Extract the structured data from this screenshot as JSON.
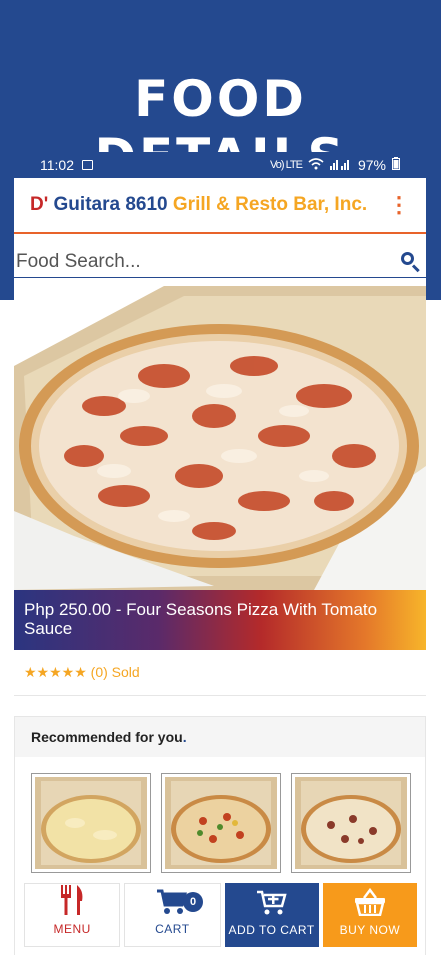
{
  "page": {
    "title": "FOOD DETAILS"
  },
  "status_bar": {
    "time": "11:02",
    "network": "Vo) LTE",
    "battery": "97%"
  },
  "app_bar": {
    "brand_prefix": "D'",
    "brand_name": "Guitara 8610",
    "brand_suffix": "Grill & Resto Bar, Inc."
  },
  "search": {
    "placeholder": "Food Search..."
  },
  "product": {
    "price_title": "Php 250.00 - Four Seasons Pizza With Tomato Sauce",
    "stars": "★★★★★",
    "sold": "(0) Sold"
  },
  "recommended": {
    "heading": "Recommended for you",
    "heading_dot": "."
  },
  "bottom_nav": {
    "menu_label": "MENU",
    "cart_label": "CART",
    "cart_count": "0",
    "add_to_cart_label": "ADD TO CART",
    "buy_now_label": "BUY NOW"
  },
  "colors": {
    "primary": "#24498f",
    "accent": "#f79a1b",
    "red": "#c62828",
    "orange_line": "#e8632a"
  },
  "icons": [
    "image-icon",
    "wifi-icon",
    "signal-icon",
    "battery-icon",
    "more-vert-icon",
    "search-icon",
    "fork-knife-icon",
    "cart-icon",
    "add-cart-icon",
    "basket-icon"
  ]
}
